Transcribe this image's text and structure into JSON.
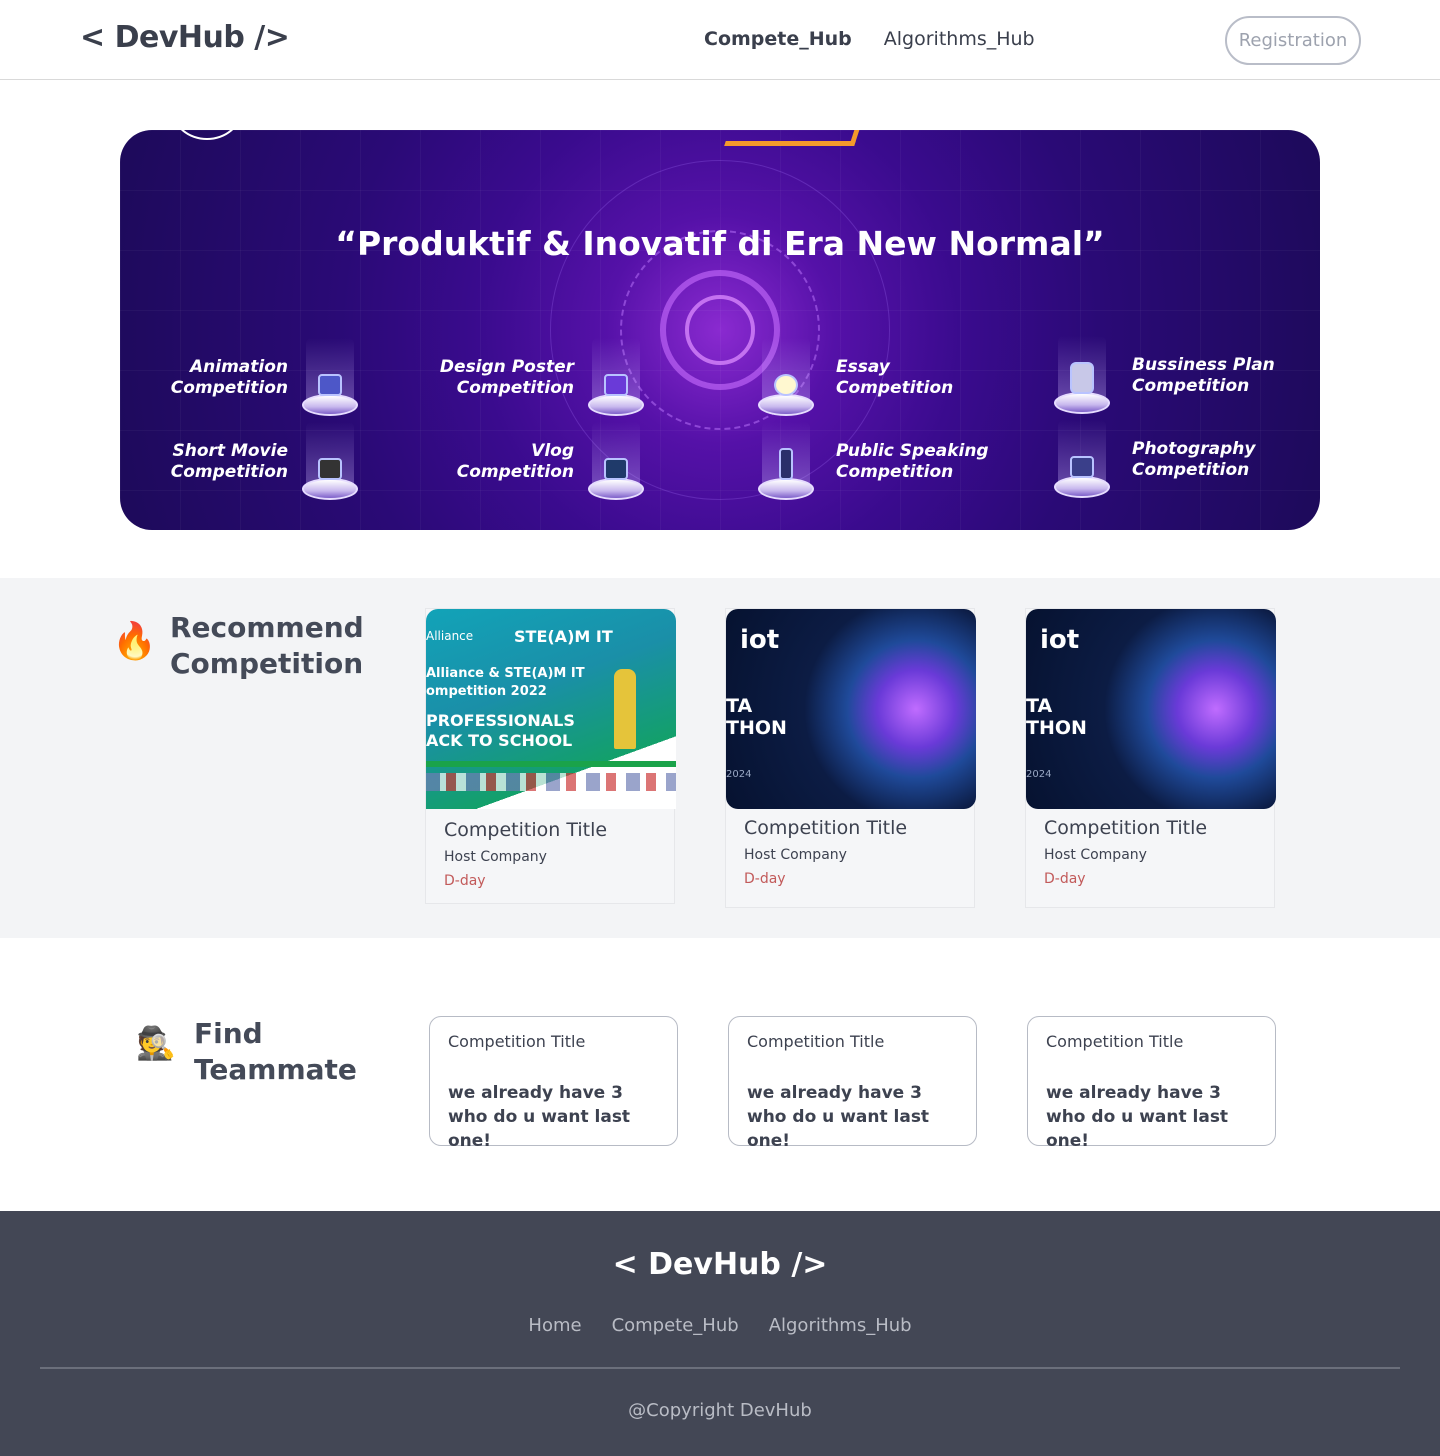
{
  "header": {
    "logo": "< DevHub />",
    "nav": [
      "Compete_Hub",
      "Algorithms_Hub"
    ],
    "registration": "Registration"
  },
  "banner": {
    "title": "“Produktif & Inovatif di Era New Normal”",
    "competitions": [
      "Animation Competition",
      "Short Movie Competition",
      "Design Poster Competition",
      "Vlog Competition",
      "Essay Competition",
      "Public Speaking Competition",
      "Bussiness Plan Competition",
      "Photography Competition"
    ],
    "competition_lines": [
      [
        "Animation",
        "Competition"
      ],
      [
        "Short Movie",
        "Competition"
      ],
      [
        "Design Poster",
        "Competition"
      ],
      [
        "Vlog",
        "Competition"
      ],
      [
        "Essay",
        "Competition"
      ],
      [
        "Public Speaking",
        "Competition"
      ],
      [
        "Bussiness Plan",
        "Competition"
      ],
      [
        "Photography",
        "Competition"
      ]
    ]
  },
  "recommend": {
    "emoji": "🔥",
    "title_line1": "Recommend",
    "title_line2": "Competition",
    "cards": [
      {
        "title": "Competition Title",
        "host": "Host Company",
        "dday": "D-day",
        "image": {
          "alliance": "Alliance",
          "steam": "STE(A)M IT",
          "line1": "Alliance & STE(A)M IT",
          "line2": "ompetition 2022",
          "line3": "PROFESSIONALS",
          "line4": "ACK TO SCHOOL"
        }
      },
      {
        "title": "Competition Title",
        "host": "Host Company",
        "dday": "D-day",
        "image": {
          "logo": "iot",
          "line1": "TA",
          "line2": "THON",
          "year": "2024"
        }
      },
      {
        "title": "Competition Title",
        "host": "Host Company",
        "dday": "D-day",
        "image": {
          "logo": "iot",
          "line1": "TA",
          "line2": "THON",
          "year": "2024"
        }
      }
    ]
  },
  "teammate": {
    "emoji": "🕵️",
    "title_line1": "Find",
    "title_line2": "Teammate",
    "cards": [
      {
        "title": "Competition Title",
        "line1": "we already have 3",
        "line2": "who do u want last one!"
      },
      {
        "title": "Competition Title",
        "line1": "we already have 3",
        "line2": "who do u want last one!"
      },
      {
        "title": "Competition Title",
        "line1": "we already have 3",
        "line2": "who do u want last one!"
      }
    ]
  },
  "footer": {
    "logo": "< DevHub />",
    "nav": [
      "Home",
      "Compete_Hub",
      "Algorithms_Hub"
    ],
    "copyright": "@Copyright DevHub"
  },
  "colors": {
    "text_dark": "#3a3f4c",
    "dday_red": "#c25a5a",
    "footer_bg": "#434755",
    "section_bg": "#f3f4f6",
    "banner_purple": "#3a0b8e"
  }
}
